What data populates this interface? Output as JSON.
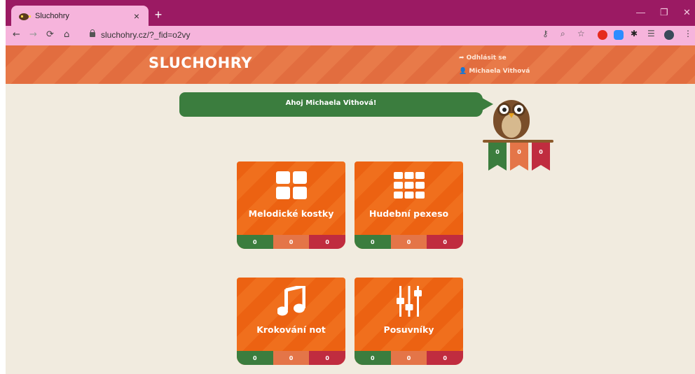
{
  "browser": {
    "tab_title": "Sluchohry",
    "tab_close": "×",
    "new_tab": "+",
    "url": "sluchohry.cz/?_fid=o2vy",
    "controls": {
      "minimize": "—",
      "restore": "❐",
      "close": "✕"
    },
    "nav": {
      "back": "←",
      "forward": "→",
      "reload": "⟳",
      "home": "⌂"
    }
  },
  "header": {
    "logo": "SLUCHOHRY",
    "logout": "➦ Odhlásit se",
    "user": "👤 Michaela Vithová"
  },
  "greeting": "Ahoj Michaela Vithová!",
  "owl_scores": [
    "0",
    "0",
    "0"
  ],
  "colors": {
    "green": "#3b7d3e",
    "orange": "#e47548",
    "red": "#c02c3f"
  },
  "games": [
    {
      "title": "Melodické kostky",
      "icon": "grid-2x2-icon",
      "scores": [
        "0",
        "0",
        "0"
      ]
    },
    {
      "title": "Hudební pexeso",
      "icon": "grid-3x3-icon",
      "scores": [
        "0",
        "0",
        "0"
      ]
    },
    {
      "title": "Krokování not",
      "icon": "music-note-icon",
      "scores": [
        "0",
        "0",
        "0"
      ]
    },
    {
      "title": "Posuvníky",
      "icon": "sliders-icon",
      "scores": [
        "0",
        "0",
        "0"
      ]
    }
  ]
}
